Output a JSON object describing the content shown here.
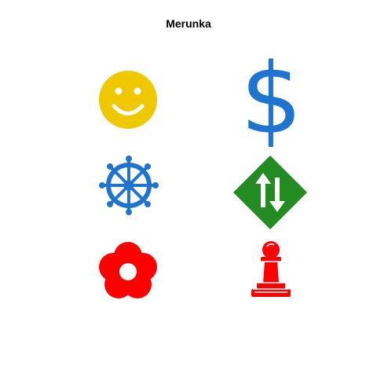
{
  "title": "Merunka",
  "icons": [
    {
      "name": "smiley-icon",
      "color": "#F0C800"
    },
    {
      "name": "dollar-sign-icon",
      "glyph": "$",
      "color": "#1F74D0"
    },
    {
      "name": "dharma-wheel-icon",
      "color": "#1F74D0"
    },
    {
      "name": "up-down-arrows-diamond-icon",
      "color": "#228B22"
    },
    {
      "name": "flower-icon",
      "color": "#FF0000"
    },
    {
      "name": "chess-pawn-icon",
      "color": "#FF0000"
    }
  ]
}
